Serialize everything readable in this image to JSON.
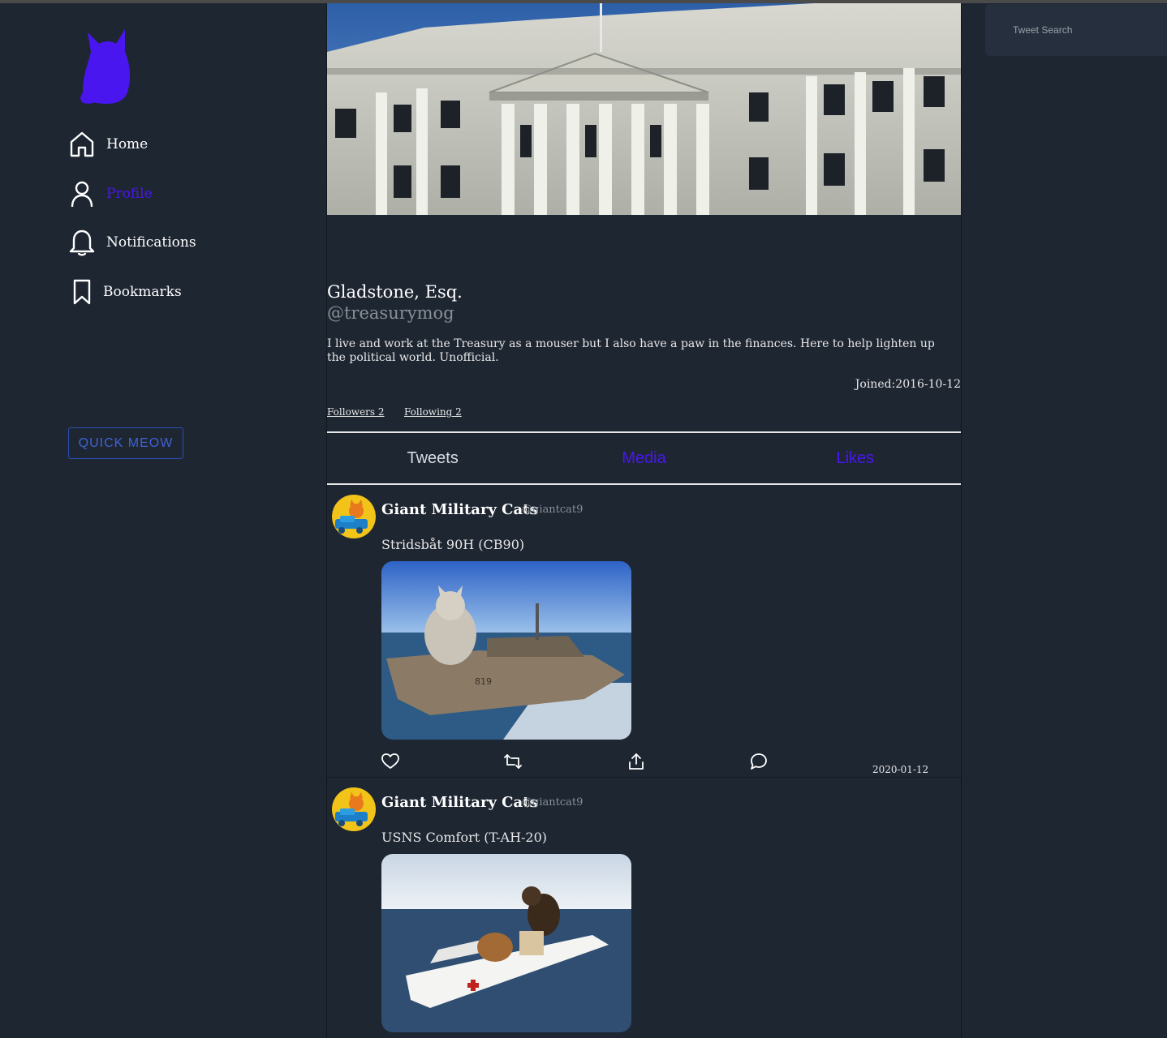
{
  "sidebar": {
    "logo": "cat-logo-icon",
    "nav": [
      {
        "label": "Home",
        "icon": "home-icon",
        "active": false
      },
      {
        "label": "Profile",
        "icon": "user-icon",
        "active": true
      },
      {
        "label": "Notifications",
        "icon": "bell-icon",
        "active": false
      },
      {
        "label": "Bookmarks",
        "icon": "bookmark-icon",
        "active": false
      }
    ],
    "quick_meow": "QUICK MEOW"
  },
  "profile": {
    "name": "Gladstone, Esq.",
    "handle": "@treasurymog",
    "bio": "I live and work at the Treasury as a mouser but I also have a paw in the finances. Here to help lighten up the political world. Unofficial.",
    "joined": "Joined:2016-10-12",
    "followers": "Followers 2",
    "following": "Following 2"
  },
  "tabs": [
    {
      "label": "Tweets",
      "active": true
    },
    {
      "label": "Media",
      "active": false
    },
    {
      "label": "Likes",
      "active": false
    }
  ],
  "tweets": [
    {
      "name": "Giant Military Cats",
      "handle": "@giantcat9",
      "text": "Stridsbåt 90H (CB90)",
      "date": "2020-01-12"
    },
    {
      "name": "Giant Military Cats",
      "handle": "@giantcat9",
      "text": "USNS Comfort (T-AH-20)",
      "date": ""
    }
  ],
  "search": {
    "placeholder": "Tweet Search"
  },
  "colors": {
    "background": "#1e2632",
    "accent": "#4a16f0",
    "muted": "#8a8f96",
    "button_border": "#2b4fb3"
  }
}
